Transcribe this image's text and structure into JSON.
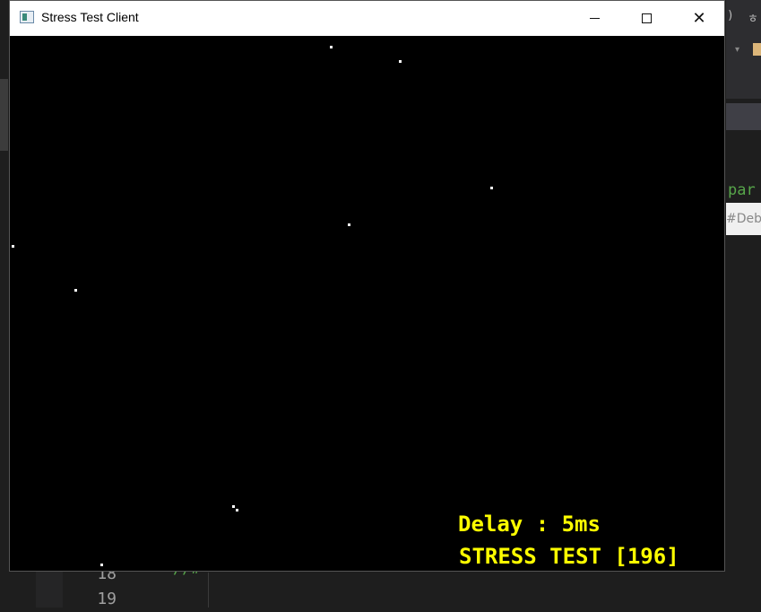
{
  "window": {
    "title": "Stress Test Client",
    "icon": "app-window-icon",
    "controls": [
      "minimize-icon",
      "maximize-icon",
      "close-icon"
    ]
  },
  "hud": {
    "delay_text": "Delay : 5ms",
    "stress_text": "STRESS TEST [196]",
    "color": "#ffff00"
  },
  "ide_background": {
    "line_numbers": [
      "18",
      "19"
    ],
    "comment_fragment": "//#",
    "code_fragment": "par",
    "hint_fragment": "#Debu"
  }
}
